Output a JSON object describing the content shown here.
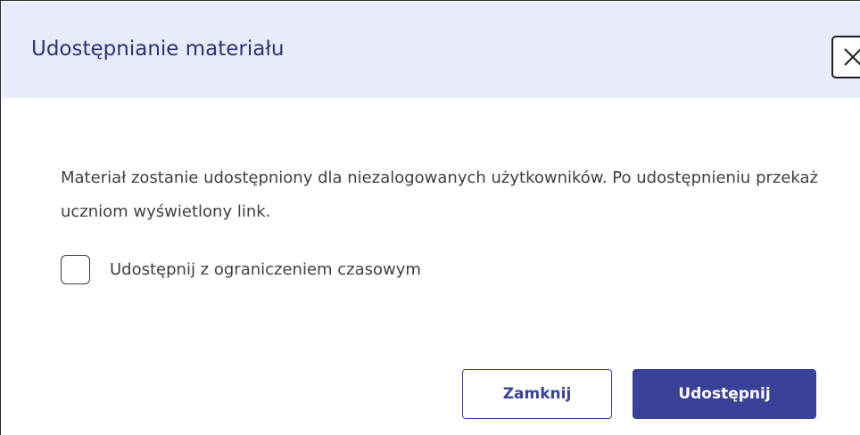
{
  "dialog": {
    "title": "Udostępnianie materiału",
    "close_icon": "close-icon",
    "message": "Materiał zostanie udostępniony dla niezalogowanych użytkowników. Po udostępnieniu przekaż uczniom wyświetlony link.",
    "checkbox": {
      "label": "Udostępnij z ograniczeniem czasowym",
      "checked": false
    },
    "buttons": {
      "close_label": "Zamknij",
      "share_label": "Udostępnij"
    }
  },
  "colors": {
    "header_background": "#e7ebfa",
    "title_text": "#2e3473",
    "accent": "#3a4199",
    "body_text": "#3f3f3f"
  }
}
